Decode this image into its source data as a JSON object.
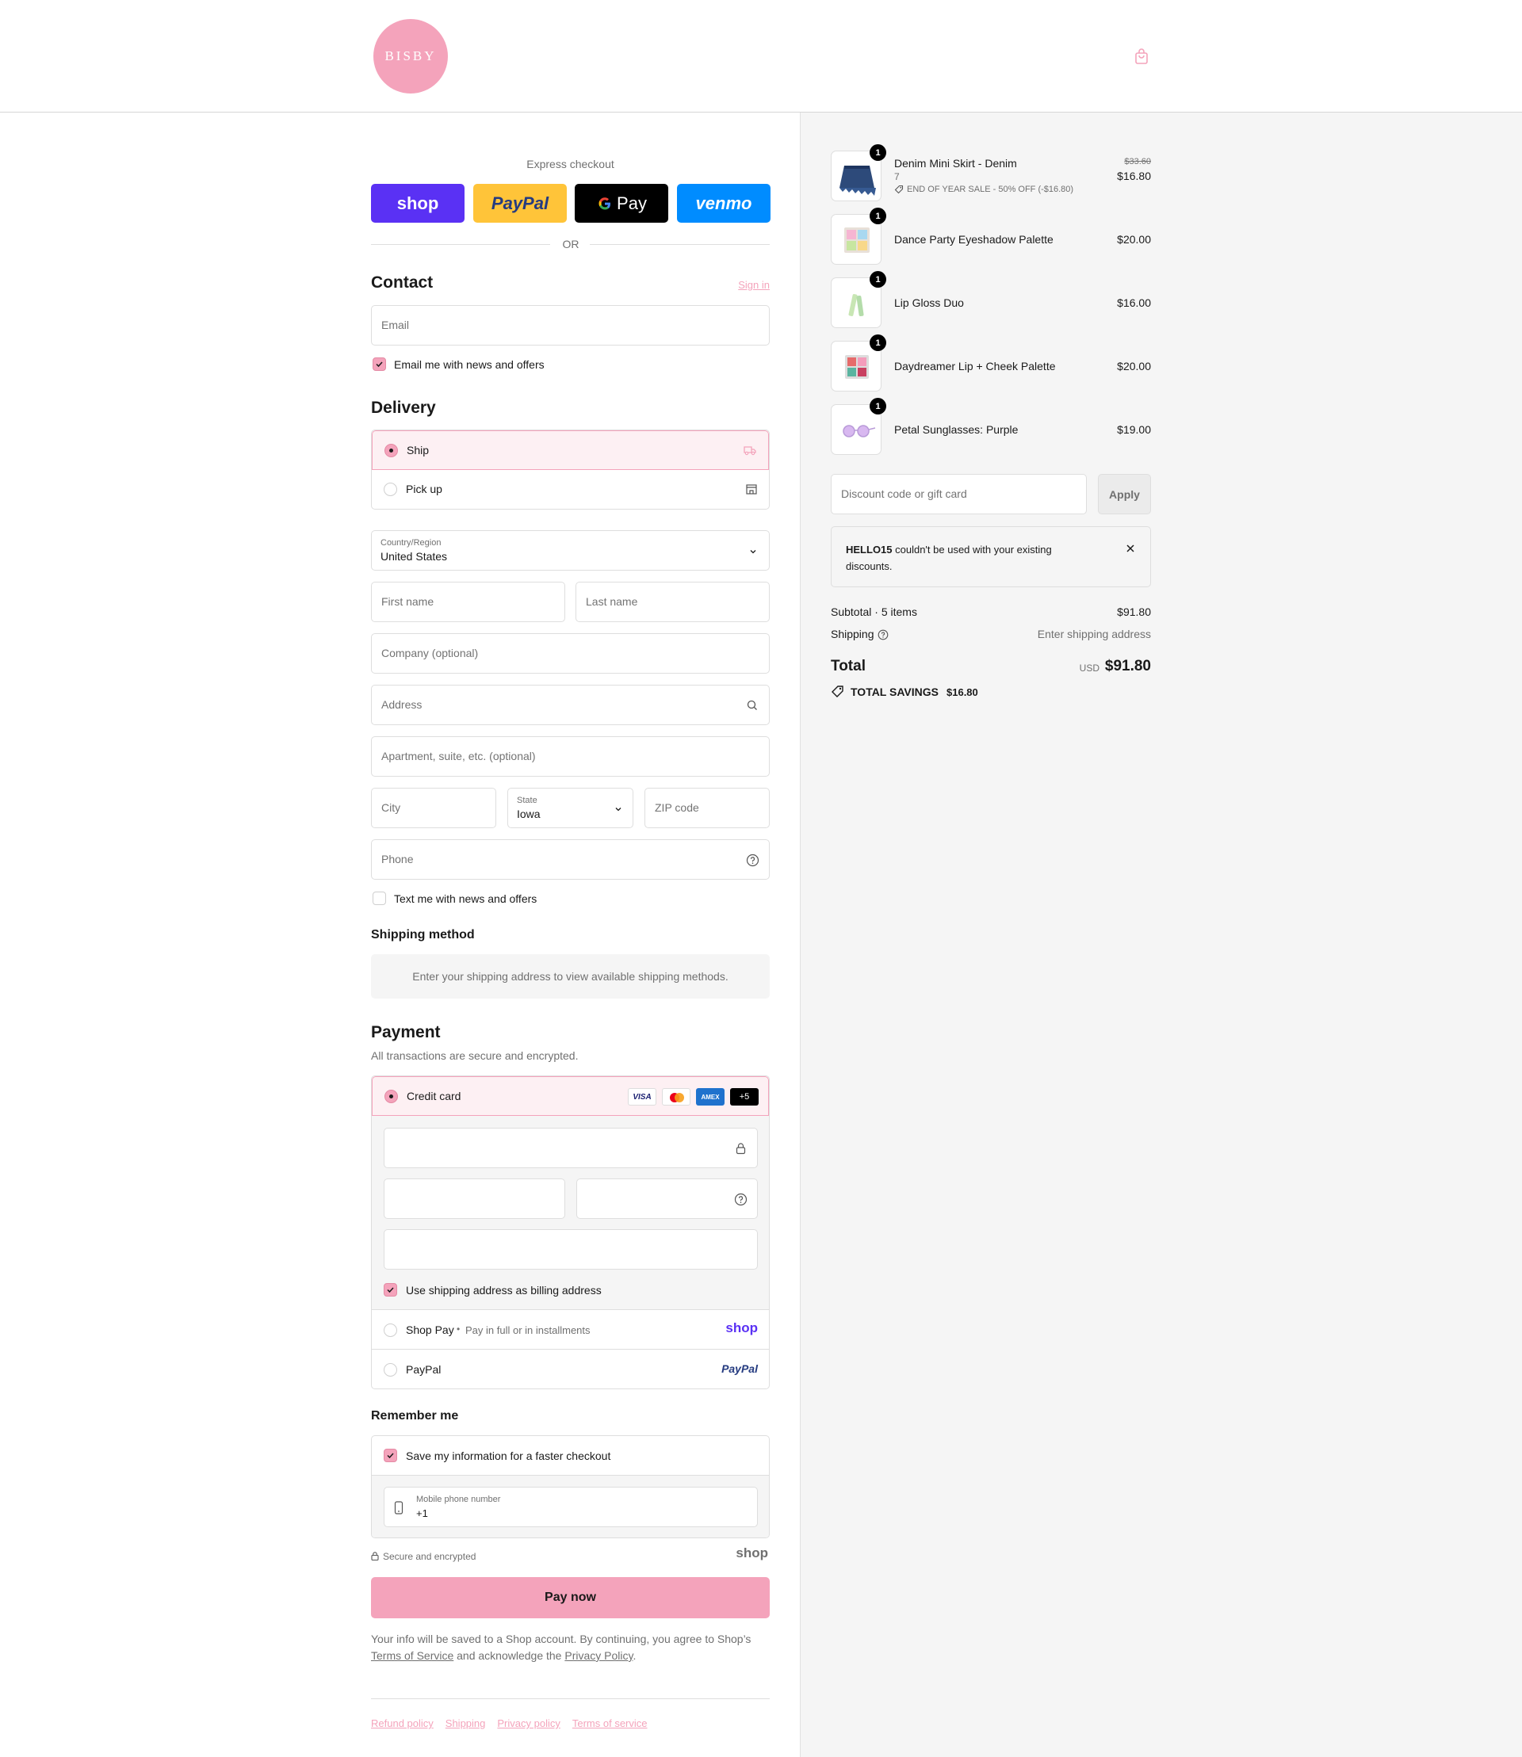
{
  "brand": {
    "logo_text": "BISBY",
    "accent": "#f4a3bb"
  },
  "header": {
    "cart_icon": "shopping-bag-icon"
  },
  "express": {
    "title": "Express checkout",
    "buttons": [
      {
        "label": "shop",
        "bg": "#5a31f4",
        "fg": "#ffffff"
      },
      {
        "label": "PayPal",
        "bg": "#ffc439",
        "fg": "#253b80"
      },
      {
        "label": "Pay",
        "bg": "#000000",
        "fg": "#ffffff"
      },
      {
        "label": "venmo",
        "bg": "#008cff",
        "fg": "#ffffff"
      }
    ],
    "or": "OR"
  },
  "contact": {
    "title": "Contact",
    "sign_in": "Sign in",
    "email_placeholder": "Email",
    "newsletter_label": "Email me with news and offers",
    "newsletter_checked": true
  },
  "delivery": {
    "title": "Delivery",
    "options": [
      {
        "label": "Ship",
        "selected": true,
        "icon": "truck-icon"
      },
      {
        "label": "Pick up",
        "selected": false,
        "icon": "store-icon"
      }
    ],
    "country_label": "Country/Region",
    "country_value": "United States",
    "first_name": "First name",
    "last_name": "Last name",
    "company": "Company (optional)",
    "address": "Address",
    "apartment": "Apartment, suite, etc. (optional)",
    "city": "City",
    "state_label": "State",
    "state_value": "Iowa",
    "zip": "ZIP code",
    "phone": "Phone",
    "text_offers_label": "Text me with news and offers",
    "text_offers_checked": false
  },
  "shipping_method": {
    "title": "Shipping method",
    "notice": "Enter your shipping address to view available shipping methods."
  },
  "payment": {
    "title": "Payment",
    "subtitle": "All transactions are secure and encrypted.",
    "credit_card_label": "Credit card",
    "card_brands": [
      "VISA",
      "",
      "AMEX",
      "+5"
    ],
    "billing_label": "Use shipping address as billing address",
    "billing_checked": true,
    "shop_pay_label": "Shop Pay",
    "shop_pay_sep": "•",
    "shop_pay_sub": "Pay in full or in installments",
    "shop_pay_logo": "shop",
    "paypal_label": "PayPal",
    "paypal_logo": "PayPal"
  },
  "remember": {
    "title": "Remember me",
    "save_label": "Save my information for a faster checkout",
    "save_checked": true,
    "phone_label": "Mobile phone number",
    "phone_value": "+1",
    "secure_text": "Secure and encrypted",
    "shop_logo": "shop"
  },
  "pay_button": "Pay now",
  "legal": {
    "text1": "Your info will be saved to a Shop account. By continuing, you agree to Shop’s",
    "tos": "Terms of Service",
    "text2": "and acknowledge the",
    "privacy": "Privacy Policy",
    "end": "."
  },
  "footer_links": [
    "Refund policy",
    "Shipping",
    "Privacy policy",
    "Terms of service"
  ],
  "order": {
    "items": [
      {
        "name": "Denim Mini Skirt - Denim",
        "variant": "7",
        "discount": "END OF YEAR SALE - 50% OFF (-$16.80)",
        "old_price": "$33.60",
        "price": "$16.80",
        "qty": "1"
      },
      {
        "name": "Dance Party Eyeshadow Palette",
        "price": "$20.00",
        "qty": "1"
      },
      {
        "name": "Lip Gloss Duo",
        "price": "$16.00",
        "qty": "1"
      },
      {
        "name": "Daydreamer Lip + Cheek Palette",
        "price": "$20.00",
        "qty": "1"
      },
      {
        "name": "Petal Sunglasses: Purple",
        "price": "$19.00",
        "qty": "1"
      }
    ],
    "discount_placeholder": "Discount code or gift card",
    "apply": "Apply",
    "alert_code": "HELLO15",
    "alert_text": " couldn't be used with your existing discounts.",
    "subtotal_label": "Subtotal · 5 items",
    "subtotal_value": "$91.80",
    "shipping_label": "Shipping",
    "shipping_value": "Enter shipping address",
    "total_label": "Total",
    "currency": "USD",
    "total_value": "$91.80",
    "savings_label": "TOTAL SAVINGS",
    "savings_value": "$16.80"
  }
}
